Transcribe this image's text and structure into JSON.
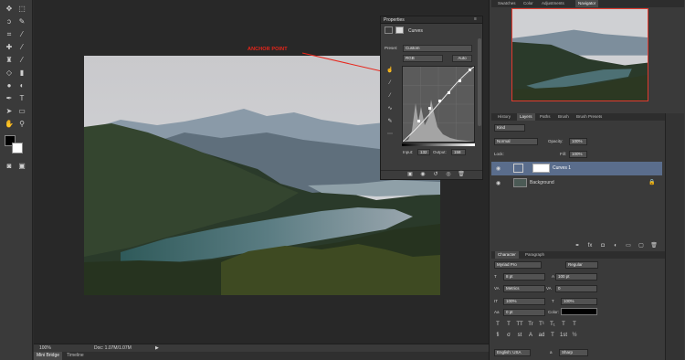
{
  "annotation": {
    "text": "ANCHOR POINT"
  },
  "properties": {
    "title": "Properties",
    "adjustment": "Curves",
    "preset_label": "Preset:",
    "preset_value": "Custom",
    "channel_value": "RGB",
    "auto_label": "Auto",
    "input_label": "Input:",
    "input_value": "132",
    "output_label": "Output:",
    "output_value": "158"
  },
  "status": {
    "zoom": "100%",
    "doc": "Doc: 1.07M/1.07M"
  },
  "bottom_tabs": [
    "Mini Bridge",
    "Timeline"
  ],
  "top_right_tabs": [
    "Swatches",
    "Color",
    "Adjustments",
    "Navigator"
  ],
  "layers_tabs": [
    "History",
    "Layers",
    "Paths",
    "Brush",
    "Brush Presets"
  ],
  "layers": {
    "filter_label": "Kind",
    "blend_mode": "Normal",
    "opacity_label": "Opacity:",
    "opacity_value": "100%",
    "lock_label": "Lock:",
    "fill_label": "Fill:",
    "fill_value": "100%",
    "items": [
      {
        "name": "Curves 1"
      },
      {
        "name": "Background"
      }
    ]
  },
  "character_tabs": [
    "Character",
    "Paragraph"
  ],
  "character": {
    "font_family": "Myriad Pro",
    "font_style": "Regular",
    "font_size": "8 pt",
    "leading": "100 pt",
    "kerning": "Metrics",
    "tracking": "0",
    "vscale": "100%",
    "hscale": "100%",
    "baseline": "0 pt",
    "color_label": "Color:",
    "language": "English: USA",
    "antialias": "Sharp",
    "style_buttons": [
      "T",
      "T",
      "TT",
      "Tr",
      "T¹",
      "T₁",
      "T",
      "T"
    ],
    "ot_buttons": [
      "fi",
      "σ",
      "st",
      "A",
      "ad",
      "T",
      "1st",
      "½"
    ]
  },
  "colors": {
    "annotation": "#e8251a",
    "selected_layer": "#5a6d8c",
    "navigator_frame": "#e23a2f"
  }
}
